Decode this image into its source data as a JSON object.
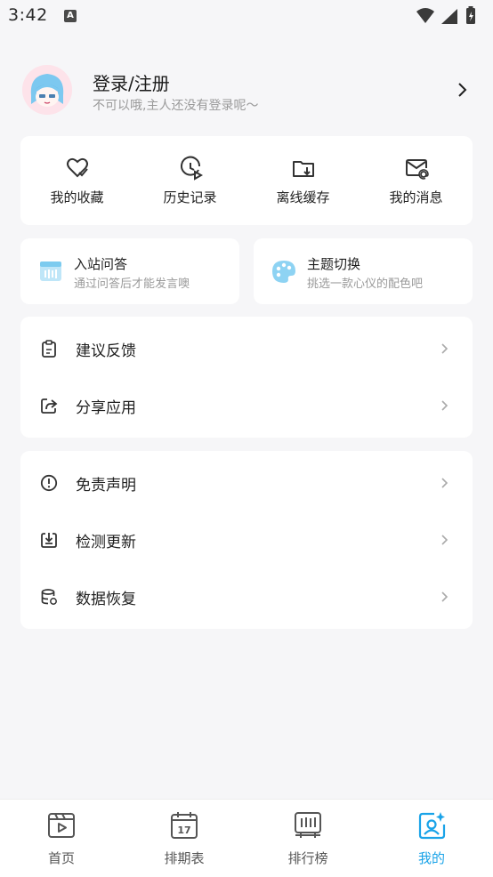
{
  "status_bar": {
    "time": "3:42",
    "notification_badge": "A"
  },
  "profile": {
    "title": "登录/注册",
    "subtitle": "不可以哦,主人还没有登录呢～"
  },
  "quick_actions": [
    {
      "label": "我的收藏",
      "icon": "heart-check-icon"
    },
    {
      "label": "历史记录",
      "icon": "clock-play-icon"
    },
    {
      "label": "离线缓存",
      "icon": "folder-download-icon"
    },
    {
      "label": "我的消息",
      "icon": "mail-at-icon"
    }
  ],
  "feature_cards": [
    {
      "title": "入站问答",
      "subtitle": "通过问答后才能发言噢",
      "icon": "quiz-icon"
    },
    {
      "title": "主题切换",
      "subtitle": "挑选一款心仪的配色吧",
      "icon": "palette-icon"
    }
  ],
  "menu_group_1": [
    {
      "label": "建议反馈",
      "icon": "clipboard-icon"
    },
    {
      "label": "分享应用",
      "icon": "share-icon"
    }
  ],
  "menu_group_2": [
    {
      "label": "免责声明",
      "icon": "info-circle-icon"
    },
    {
      "label": "检测更新",
      "icon": "download-box-icon"
    },
    {
      "label": "数据恢复",
      "icon": "database-restore-icon"
    }
  ],
  "bottom_nav": [
    {
      "label": "首页",
      "icon": "home-video-icon"
    },
    {
      "label": "排期表",
      "icon": "calendar-icon",
      "badge": "17"
    },
    {
      "label": "排行榜",
      "icon": "ranking-icon"
    },
    {
      "label": "我的",
      "icon": "profile-sparkle-icon",
      "active": true
    }
  ],
  "colors": {
    "accent": "#1aa3e8",
    "background": "#f6f6f8",
    "card": "#ffffff"
  }
}
